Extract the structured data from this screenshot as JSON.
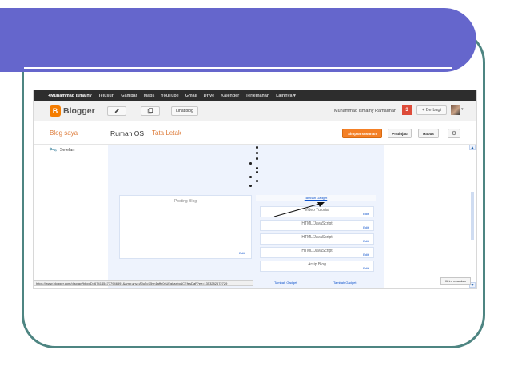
{
  "colors": {
    "banner": "#6566cc",
    "frame": "#4e8582",
    "accent_orange": "#f48026",
    "notification_red": "#dd4b39",
    "editor_bg": "#eef3fd"
  },
  "google_bar": {
    "items": [
      "+Muhammad Ismainy",
      "Telusuri",
      "Gambar",
      "Maps",
      "YouTube",
      "Gmail",
      "Drive",
      "Kalender",
      "Terjemahan",
      "Lainnya ▾"
    ]
  },
  "header": {
    "logo_text": "Blogger",
    "view_blog_label": "Lihat blog",
    "user_name": "Muhammad Ismainy Ramadhan",
    "notification_count": "3",
    "share_label": "+ Berbagi",
    "pencil_icon": "pencil-icon",
    "copy_icon": "copy-icon"
  },
  "blog_bar": {
    "my_blogs": "Blog saya",
    "blog_name": "Rumah OS",
    "separator": "·",
    "current_page": "Tata Letak",
    "save_label": "Simpan susunan",
    "preview_label": "Pratinjau",
    "clear_label": "Hapus",
    "gear_icon": "gear-icon"
  },
  "sidebar": {
    "settings_label": "Setelan",
    "wrench_icon": "wrench-icon"
  },
  "layout": {
    "posts_title": "Posting Blog",
    "posts_edit": "Edit",
    "add_gadget_top": "Tambah Gadget",
    "gadgets": [
      {
        "title": "Video Tutorial",
        "edit": "Edit"
      },
      {
        "title": "HTML/JavaScript",
        "edit": "Edit"
      },
      {
        "title": "HTML/JavaScript",
        "edit": "Edit"
      },
      {
        "title": "HTML/JavaScript",
        "edit": "Edit"
      },
      {
        "title": "Arsip Blog",
        "edit": "Edit"
      }
    ],
    "add_gadget_bottom_left": "Tambah Gadget",
    "add_gadget_bottom_right": "Tambah Gadget"
  },
  "status_bar": {
    "url": "https://www.blogger.com/display?blogID=6741454737946591&amp;anv=A0u2cS5vn1affn0cUEgkaxbo1CEfesDaF?ez=1353282672729"
  },
  "feedback_label": "Kirim masukan"
}
